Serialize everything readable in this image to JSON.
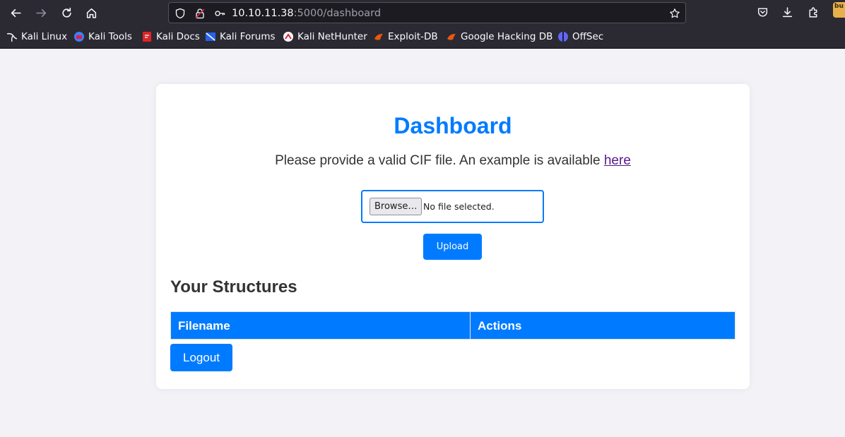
{
  "browser": {
    "url_host": "10.10.11.38",
    "url_path": ":5000/dashboard",
    "bookmarks": [
      {
        "label": "Kali Linux",
        "icon": "kali-dragon-icon"
      },
      {
        "label": "Kali Tools",
        "icon": "kali-tools-icon"
      },
      {
        "label": "Kali Docs",
        "icon": "kali-docs-icon"
      },
      {
        "label": "Kali Forums",
        "icon": "kali-forums-icon"
      },
      {
        "label": "Kali NetHunter",
        "icon": "kali-nethunter-icon"
      },
      {
        "label": "Exploit-DB",
        "icon": "exploit-db-icon"
      },
      {
        "label": "Google Hacking DB",
        "icon": "google-hacking-db-icon"
      },
      {
        "label": "OffSec",
        "icon": "offsec-icon"
      }
    ],
    "avatar_text": "bu"
  },
  "page": {
    "title": "Dashboard",
    "instructions": "Please provide a valid CIF file. An example is available ",
    "example_link": "here",
    "browse_label": "Browse…",
    "file_status": "No file selected.",
    "upload_label": "Upload",
    "structures_heading": "Your Structures",
    "table": {
      "columns": [
        "Filename",
        "Actions"
      ],
      "rows": []
    },
    "logout_label": "Logout"
  },
  "colors": {
    "accent": "#007bff",
    "background": "#f2f2f7",
    "chrome": "#2b2a33"
  }
}
